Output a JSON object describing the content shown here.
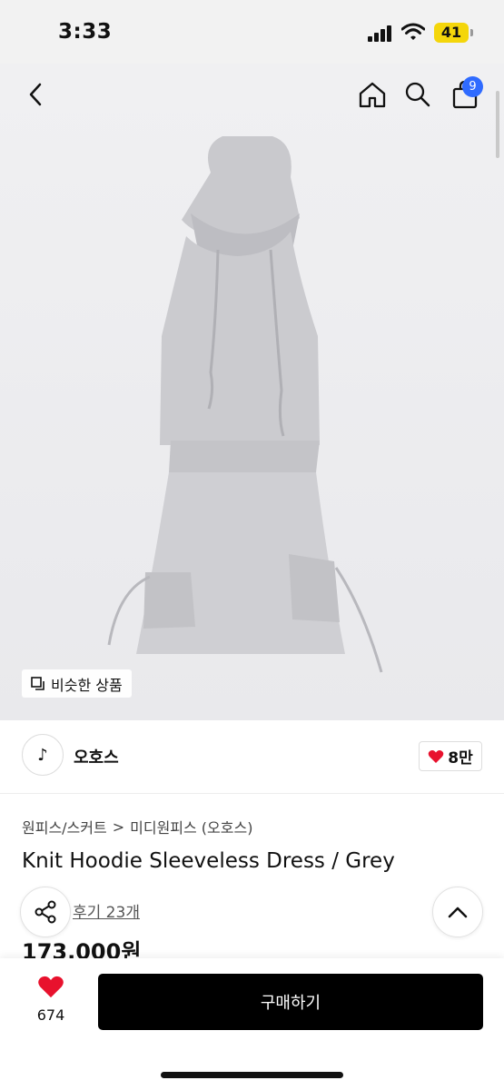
{
  "status_bar": {
    "time": "3:33",
    "battery": "41"
  },
  "nav": {
    "back_icon": "chevron-left-icon",
    "home_icon": "home-icon",
    "search_icon": "search-icon",
    "cart_icon": "shopping-bag-icon",
    "cart_badge": "9"
  },
  "image": {
    "similar_label": "비슷한 상품"
  },
  "brand": {
    "name": "오호스",
    "logo_glyph": "♪",
    "like_count": "8만"
  },
  "breadcrumb": {
    "category": "원피스/스커트",
    "separator": ">",
    "subcategory": "미디원피스 (오호스)"
  },
  "product": {
    "title": "Knit Hoodie Sleeveless Dress / Grey",
    "reviews": "후기 23개",
    "price": "173,000원"
  },
  "bottom": {
    "wish_count": "674",
    "buy_label": "구매하기"
  },
  "colors": {
    "badge": "#2f6bff",
    "heart": "#e8112d",
    "buy_button": "#000000",
    "battery": "#f4d60b"
  }
}
